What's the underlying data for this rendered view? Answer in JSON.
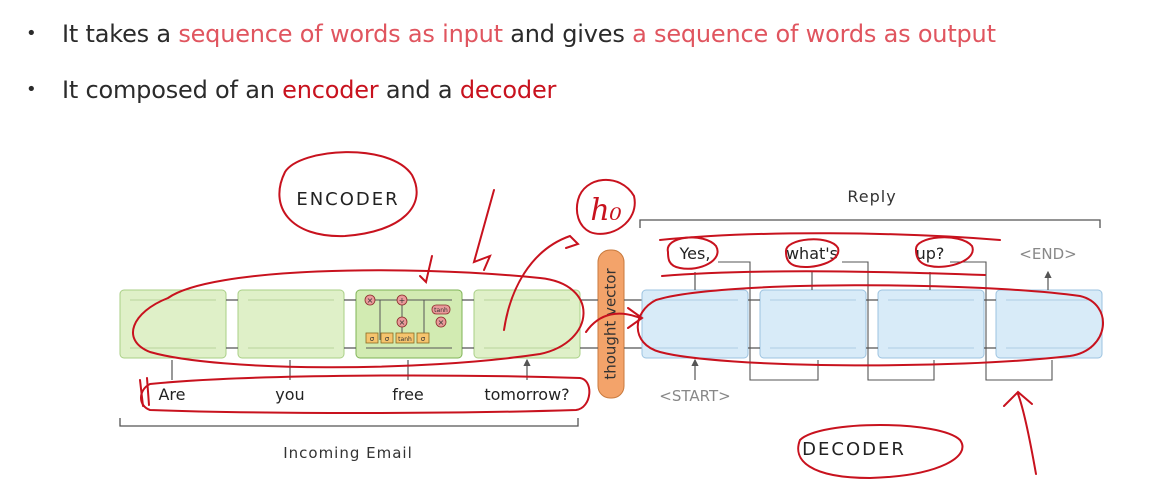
{
  "bullets": [
    {
      "parts": [
        {
          "text": "It takes a ",
          "style": "plain"
        },
        {
          "text": "sequence of words as input",
          "style": "pink"
        },
        {
          "text": " and gives ",
          "style": "plain"
        },
        {
          "text": "a sequence of words as output",
          "style": "pink"
        }
      ]
    },
    {
      "parts": [
        {
          "text": "It composed of an ",
          "style": "plain"
        },
        {
          "text": "encoder",
          "style": "red"
        },
        {
          "text": " and a ",
          "style": "plain"
        },
        {
          "text": "decoder",
          "style": "red"
        }
      ]
    }
  ],
  "diagram": {
    "encoder_title": "ENCODER",
    "decoder_title": "DECODER",
    "handwritten_h0": "h₀",
    "reply_label": "Reply",
    "incoming_label": "Incoming Email",
    "thought_vector": "thought vector",
    "input_words": [
      "Are",
      "you",
      "free",
      "tomorrow?"
    ],
    "start_token": "<START>",
    "output_words": [
      "Yes,",
      "what's",
      "up?",
      "<END>"
    ],
    "cell_text": {
      "tanh": "tanh",
      "sigma": "σ",
      "times": "×",
      "plus": "+"
    },
    "colors": {
      "encoder_fill": "#dff0c8",
      "encoder_stroke": "#a9cf86",
      "decoder_fill": "#d8ebf8",
      "decoder_stroke": "#9cc3e0",
      "thought_fill": "#f3a36a",
      "ink": "#c8121e"
    }
  }
}
